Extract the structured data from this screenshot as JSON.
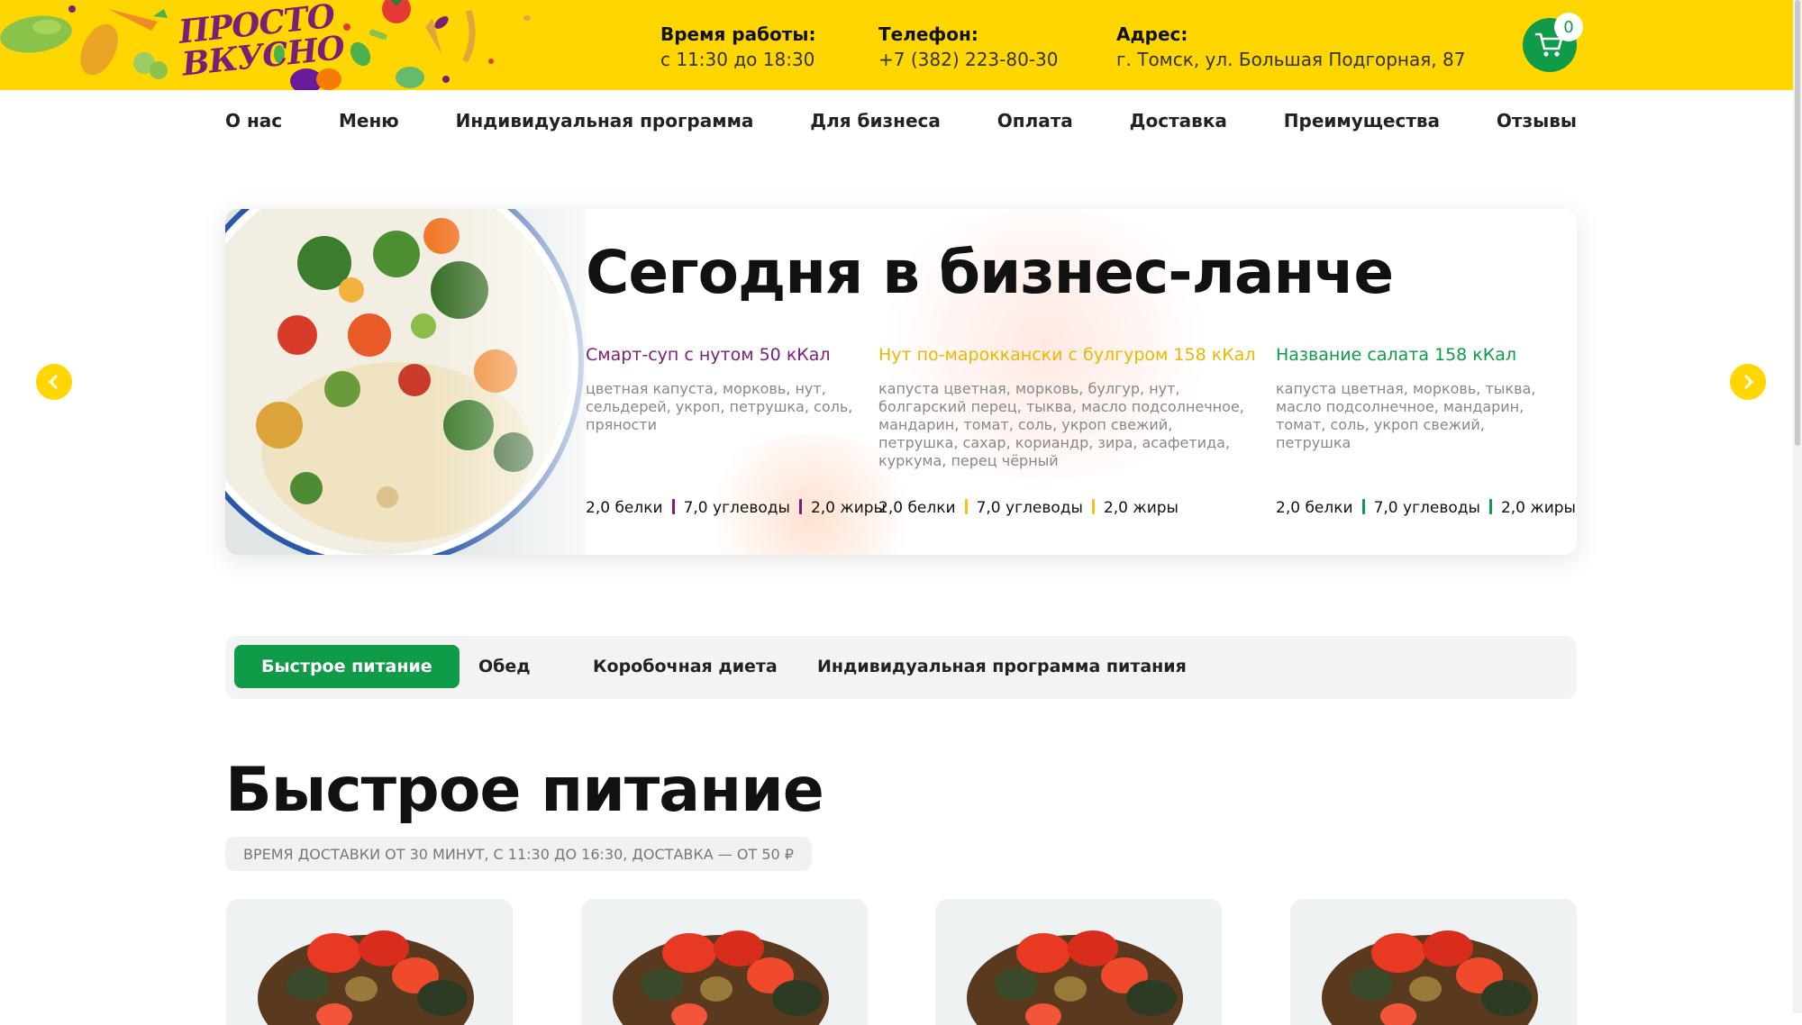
{
  "colors": {
    "header_bg": "#FFD600",
    "accent_green": "#0F9B48",
    "accent_purple": "#7B1E77",
    "accent_yellow": "#F3C11B"
  },
  "header": {
    "logo_line1": "ПРОСТО",
    "logo_line2": "ВКУСНО",
    "hours_label": "Время работы:",
    "hours_value": "с 11:30 до 18:30",
    "phone_label": "Телефон:",
    "phone_value": "+7 (382) 223-80-30",
    "address_label": "Адрес:",
    "address_value": "г. Томск, ул. Большая Подгорная, 87",
    "cart_icon": "cart-icon",
    "cart_count": "0"
  },
  "nav": {
    "items": [
      {
        "label": "О нас"
      },
      {
        "label": "Меню"
      },
      {
        "label": "Индивидуальная программа"
      },
      {
        "label": "Для бизнеса"
      },
      {
        "label": "Оплата"
      },
      {
        "label": "Доставка"
      },
      {
        "label": "Преимущества"
      },
      {
        "label": "Отзывы"
      }
    ]
  },
  "hero": {
    "title": "Сегодня в бизнес-ланче",
    "dishes": [
      {
        "name": "Смарт-суп с нутом 50 кКал",
        "ingredients": "цветная капуста, морковь, нут, сельдерей, укроп, петрушка, соль, пряности",
        "protein": "2,0 белки",
        "carbs": "7,0 углеводы",
        "fat": "2,0 жиры",
        "color": "#7B1E77"
      },
      {
        "name": "Нут по-марокканcки с булгуром 158 кКал",
        "ingredients": "капуста цветная, морковь, булгур, нут, болгарский перец, тыква, масло подсолнечное, мандарин, томат, соль, укроп свежий, петрушка, сахар, кориандр, зира, асафетида, куркума, перец чёрный",
        "protein": "2,0 белки",
        "carbs": "7,0 углеводы",
        "fat": "2,0 жиры",
        "color": "#E9B800"
      },
      {
        "name": "Название салата 158 кКал",
        "ingredients": "капуста цветная, морковь, тыква, масло подсолнечное, мандарин, томат, соль, укроп свежий, петрушка",
        "protein": "2,0 белки",
        "carbs": "7,0 углеводы",
        "fat": "2,0 жиры",
        "color": "#0F9B48"
      }
    ],
    "prev_icon": "chevron-left-icon",
    "next_icon": "chevron-right-icon"
  },
  "tabs": [
    {
      "label": "Быстрое питание",
      "active": true
    },
    {
      "label": "Обед",
      "active": false
    },
    {
      "label": "Коробочная диета",
      "active": false
    },
    {
      "label": "Индивидуальная программа питания",
      "active": false
    }
  ],
  "section": {
    "title": "Быстрое питание",
    "delivery_note": "ВРЕМЯ ДОСТАВКИ ОТ 30 МИНУТ, С 11:30 ДО 16:30, ДОСТАВКА — ОТ 50 ₽"
  }
}
